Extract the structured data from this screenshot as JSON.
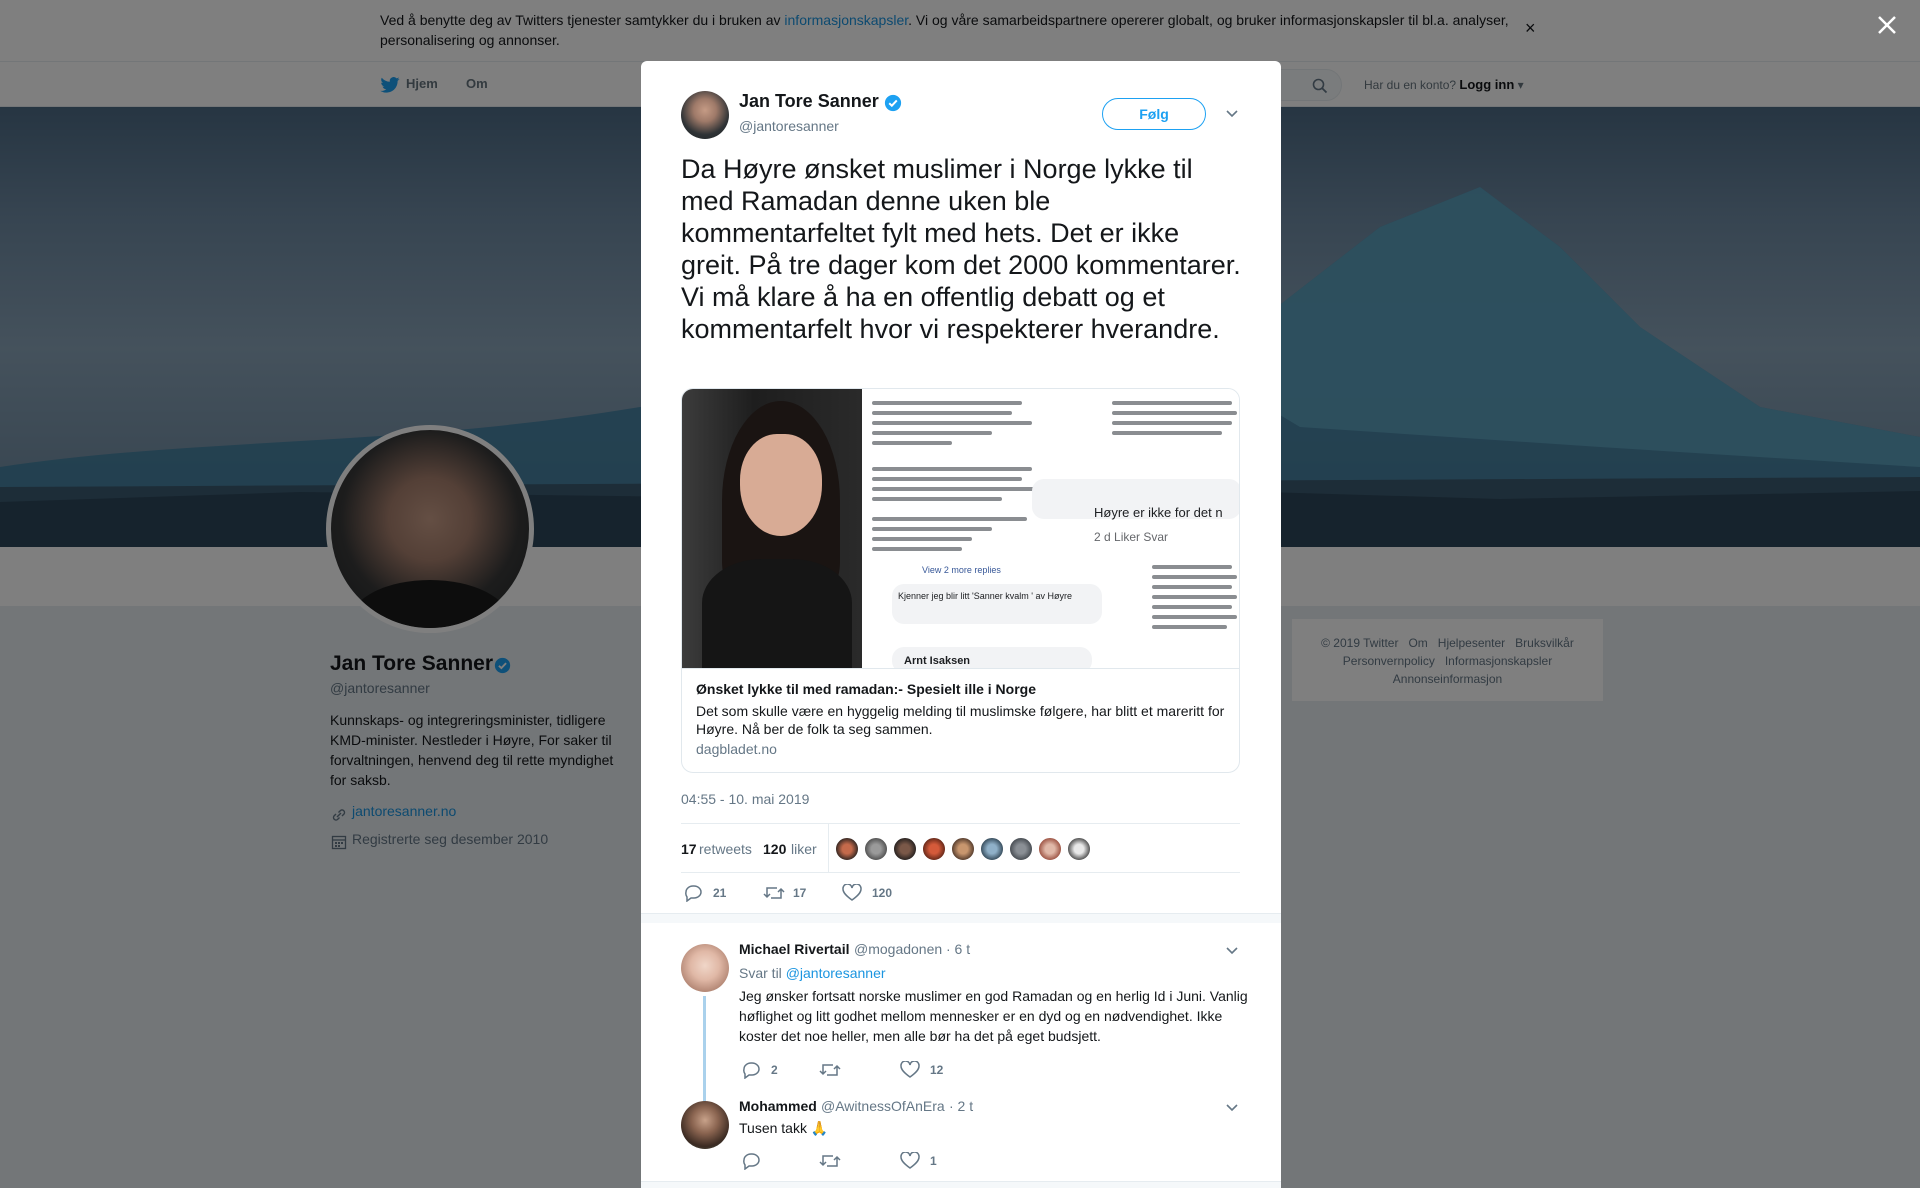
{
  "cookie_bar": {
    "text_before": "Ved å benytte deg av Twitters tjenester samtykker du i bruken av ",
    "link": "informasjonskapsler",
    "text_after": ". Vi og våre samarbeidspartnere opererer globalt, og bruker informasjonskapsler til bl.a. analyser, personalisering og annonser.",
    "close": "×"
  },
  "nav": {
    "home": "Hjem",
    "about": "Om",
    "account_prompt": "Har du en konto?",
    "login": "Logg inn"
  },
  "profile": {
    "name": "Jan Tore Sanner",
    "handle": "@jantoresanner",
    "bio": "Kunnskaps- og integreringsminister, tidligere KMD-minister. Nestleder i Høyre, For saker til forvaltningen, henvend deg til rette myndighet for saksb.",
    "link": "jantoresanner.no",
    "joined": "Registrerte seg desember 2010"
  },
  "footer": {
    "items": [
      "© 2019 Twitter",
      "Om",
      "Hjelpesenter",
      "Bruksvilkår",
      "Personvernpolicy",
      "Informasjonskapsler",
      "Annonseinformasjon"
    ]
  },
  "tweet": {
    "author_name": "Jan Tore Sanner",
    "author_handle": "@jantoresanner",
    "follow_label": "Følg",
    "text": "Da Høyre ønsket muslimer i Norge lykke til med Ramadan denne uken ble kommentarfeltet fylt med hets. Det er ikke greit. På tre dager kom det 2000 kommentarer. Vi må klare å ha en offentlig debatt og et kommentarfelt hvor vi respekterer hverandre.",
    "card": {
      "title": "Ønsket lykke til med ramadan:- Spesielt ille i Norge",
      "description": "Det som skulle være en hyggelig melding til muslimske følgere, har blitt et mareritt for Høyre. Nå ber de folk ta seg sammen.",
      "domain": "dagbladet.no",
      "image_texts": {
        "c1": "Kjenner jeg blir litt 'Sanner kvalm ' av Høyre",
        "c2": "Høyre er ikke for det n",
        "c2_meta": "2 d   Liker   Svar",
        "c3": "Arnt Isaksen",
        "view_replies": "View 2 more replies"
      }
    },
    "timestamp": "04:55 - 10. mai 2019",
    "retweets_count": "17",
    "retweets_label": "retweets",
    "likes_count": "120",
    "likes_label": "liker",
    "actions": {
      "replies": "21",
      "retweets": "17",
      "likes": "120"
    }
  },
  "replies": [
    {
      "name": "Michael Rivertail",
      "handle": "@mogadonen",
      "time": "· 6 t",
      "reply_to_prefix": "Svar til ",
      "reply_to": "@jantoresanner",
      "text": "Jeg ønsker fortsatt norske muslimer en god Ramadan og en herlig Id i Juni. Vanlig høflighet og litt godhet mellom mennesker er en dyd og en nødvendighet. Ikke koster det noe heller, men alle bør ha det på eget budsjett.",
      "replies": "2",
      "likes": "12"
    },
    {
      "name": "Mohammed",
      "handle": "@AwitnessOfAnEra",
      "time": "· 2 t",
      "text": "Tusen takk 🙏",
      "likes": "1"
    }
  ],
  "colors": {
    "accent": "#1da1f2",
    "link": "#1b95e0",
    "verified": "#1da1f2"
  }
}
